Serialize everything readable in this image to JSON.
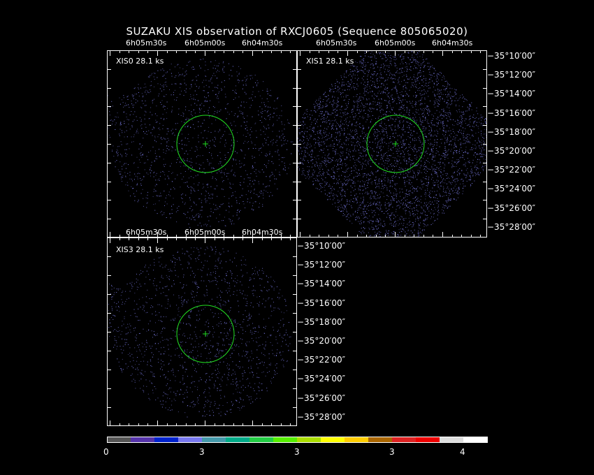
{
  "title": "SUZAKU XIS observation of RXCJ0605  (Sequence 805065020)",
  "panels": [
    {
      "label": "XIS0 28.1 ks",
      "shape": "circle-field"
    },
    {
      "label": "XIS1 28.1 ks",
      "shape": "diamond-field"
    },
    {
      "label": "XIS3 28.1 ks",
      "shape": "circle-field"
    }
  ],
  "ra_labels": [
    "6h05m30s",
    "6h05m00s",
    "6h04m30s"
  ],
  "dec_labels": [
    "−35°10′00″",
    "−35°12′00″",
    "−35°14′00″",
    "−35°16′00″",
    "−35°18′00″",
    "−35°20′00″",
    "−35°22′00″",
    "−35°24′00″",
    "−35°26′00″",
    "−35°28′00″"
  ],
  "colorbar": {
    "colors": [
      "#555555",
      "#5533aa",
      "#0022cc",
      "#7777ee",
      "#4499aa",
      "#00aa88",
      "#22cc44",
      "#55ee00",
      "#aadd00",
      "#ffff00",
      "#ffcc00",
      "#aa6600",
      "#dd2222",
      "#ee0000",
      "#dddddd",
      "#ffffff"
    ],
    "tick_labels": [
      "0",
      "3",
      "3",
      "3",
      "4"
    ]
  },
  "colors": {
    "source_region": "#22dd22",
    "events": "#8888ff",
    "background": "#000000"
  }
}
